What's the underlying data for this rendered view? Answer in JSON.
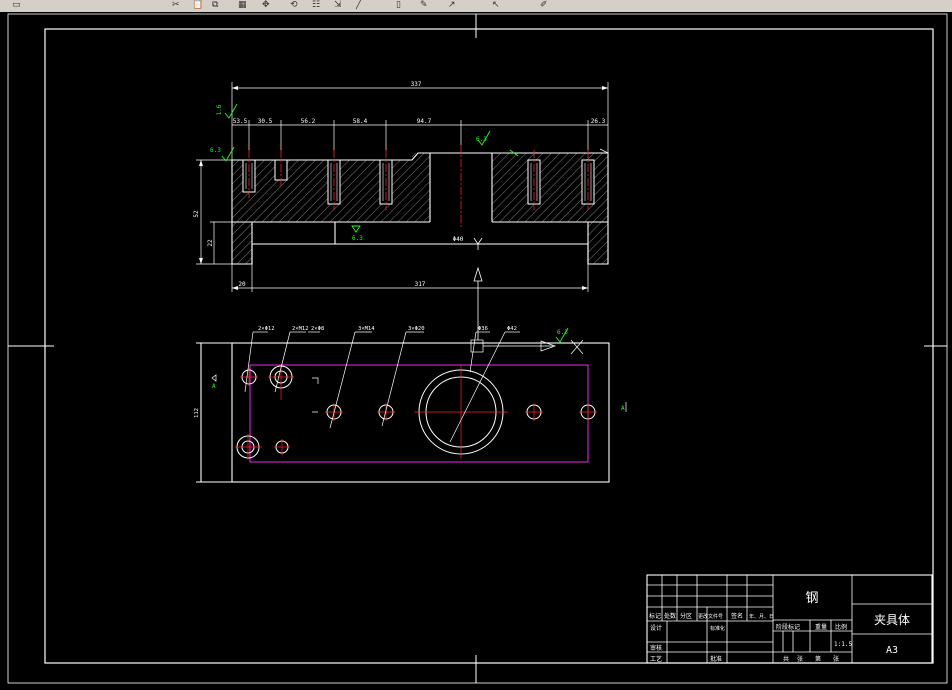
{
  "toolbar": {
    "icons": [
      "window-icon",
      "cut-icon",
      "paste-icon",
      "copy-icon",
      "table-icon",
      "pan-icon",
      "zoom-icon",
      "properties-icon",
      "match-icon",
      "line-icon",
      "rect-icon",
      "pencil-icon",
      "arrow-icon",
      "arrow-icon",
      "brush-icon"
    ]
  },
  "drawing": {
    "front_view": {
      "overall_width": "337",
      "dims_top": [
        "53.5",
        "30.5",
        "56.2",
        "58.4",
        "94.7",
        "26.3"
      ],
      "height_total": "52",
      "height_step": "22",
      "bottom_left": "20",
      "bottom_main": "317",
      "center_dim": "Φ40",
      "roughness_top_left": "1.6",
      "roughness_left": "6.3",
      "roughness_center": "6.3",
      "roughness_bottom": "6.3"
    },
    "plan_view": {
      "hole_callouts": [
        "2×Φ12",
        "2×M12",
        "2×Φ8",
        "3×M14",
        "3×Φ20",
        "Φ36",
        "Φ42"
      ],
      "width_dim": "112",
      "roughness_right": "6.3",
      "section_mark_left": "A",
      "section_mark_right": "A"
    },
    "title_block": {
      "material": "钢",
      "part_name": "夹具体",
      "sheet_size": "A3",
      "scale": "1:1.5",
      "header_row": [
        "标记",
        "处数",
        "分区",
        "更改文件号",
        "签名",
        "年、月、日"
      ],
      "row_labels": [
        "设计",
        "标准化",
        "审核",
        "工艺",
        "批准"
      ],
      "stage_labels": [
        "阶段标记",
        "重量",
        "比例"
      ],
      "sheet_row": [
        "共",
        "张",
        "第",
        "张"
      ]
    }
  },
  "colors": {
    "background": "#000000",
    "lines": "#ffffff",
    "hatch": "#bdbdbd",
    "center_line": "#ff2020",
    "outline_magenta": "#ff30ff",
    "roughness_green": "#22ff22"
  }
}
